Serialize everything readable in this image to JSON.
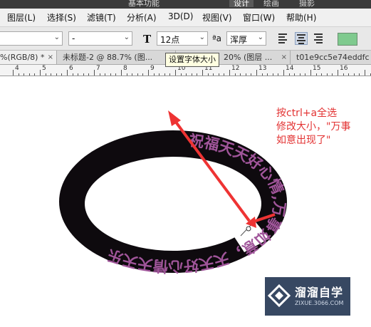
{
  "workspace": {
    "items": [
      "基本功能",
      "设计",
      "绘画",
      "摄影"
    ]
  },
  "menubar": {
    "items": [
      "图层(L)",
      "选择(S)",
      "滤镜(T)",
      "分析(A)",
      "3D(D)",
      "视图(V)",
      "窗口(W)",
      "帮助(H)"
    ]
  },
  "options": {
    "font_style_value": "-",
    "font_size_value": "12点",
    "antialias_value": "浑厚",
    "text_color": "#7fca8e"
  },
  "tabs": [
    {
      "label": "%(RGB/8) *",
      "close": "×"
    },
    {
      "label": "未标题-2 @ 88.7% (图...",
      "close": "×"
    },
    {
      "label": "20% (图层 ...",
      "close": "×"
    },
    {
      "label": "t01e9cc5e74eddfc",
      "close": ""
    }
  ],
  "ruler": {
    "numbers": [
      "4",
      "5",
      "6",
      "7",
      "8",
      "9",
      "10",
      "11",
      "12",
      "13",
      "14",
      "15",
      "16"
    ]
  },
  "tooltip": {
    "text": "设置字体大小"
  },
  "artwork": {
    "ring_text": "祝福天天好心情,万事如意，天天好心情天天乐",
    "ring_color": "#0e0a0e",
    "text_color": "#a0559a"
  },
  "annotation": {
    "lines": [
      "按ctrl+a全选",
      "修改大小，\"万事",
      "如意出现了\""
    ],
    "color": "#e33333"
  },
  "watermark": {
    "title": "溜溜自学",
    "subtitle": "ZIXUE.3066.COM"
  }
}
